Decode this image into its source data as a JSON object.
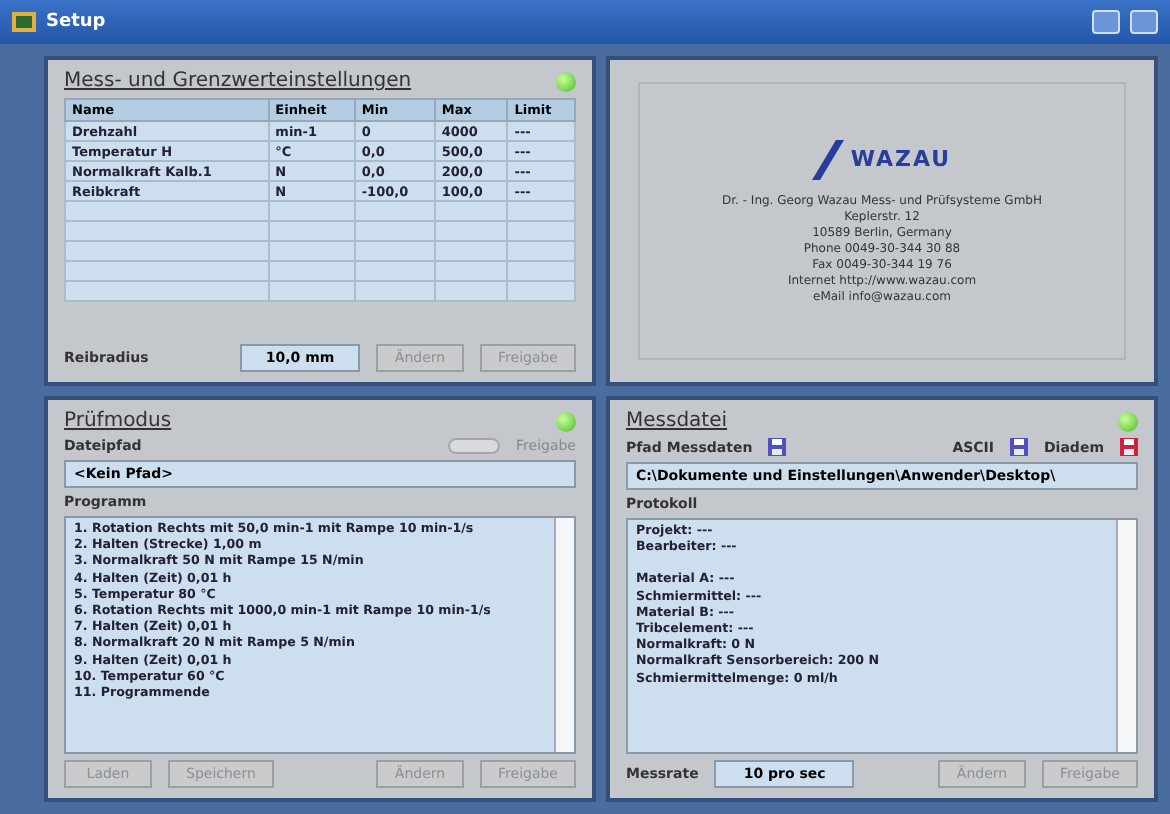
{
  "window": {
    "title": "Setup"
  },
  "limits_panel": {
    "title": "Mess- und Grenzwerteinstellungen",
    "led_on": true,
    "table": {
      "columns": [
        "Name",
        "Einheit",
        "Min",
        "Max",
        "Limit"
      ],
      "rows": [
        [
          "Drehzahl",
          "min-1",
          "0",
          "4000",
          "---"
        ],
        [
          "Temperatur H",
          "°C",
          "0,0",
          "500,0",
          "---"
        ],
        [
          "Normalkraft Kalb.1",
          "N",
          "0,0",
          "200,0",
          "---"
        ],
        [
          "Reibkraft",
          "N",
          "-100,0",
          "100,0",
          "---"
        ]
      ]
    },
    "radius": {
      "label": "Reibradius",
      "value": "10,0 mm"
    },
    "buttons": [
      {
        "label": "Ändern",
        "disabled": true
      },
      {
        "label": "Freigabe",
        "disabled": true
      }
    ]
  },
  "company_panel": {
    "logo": "WAZAU",
    "lines": [
      "Dr. - Ing. Georg Wazau Mess- und Prüfsysteme GmbH",
      "Keplerstr. 12",
      "10589 Berlin, Germany",
      "Phone 0049-30-344 30 88",
      "Fax 0049-30-344 19 76",
      "Internet http://www.wazau.com",
      "eMail info@wazau.com"
    ]
  },
  "test_panel": {
    "title": "Prüfmodus",
    "led_on": true,
    "path_label": "Dateipfad",
    "toggle_on": false,
    "toggle_label": "Freigabe",
    "path": "<Kein Pfad>",
    "program_label": "Programm",
    "program": [
      "1. Rotation Rechts mit 50,0 min-1 mit Rampe 10 min-1/s",
      "2. Halten (Strecke) 1,00 m",
      "3. Normalkraft 50 N mit Rampe 15 N/min",
      "4. Halten (Zeit) 0,01 h",
      "5. Temperatur 80 °C",
      "6. Rotation Rechts mit 1000,0 min-1 mit Rampe 10 min-1/s",
      "7. Halten (Zeit) 0,01 h",
      "8. Normalkraft 20 N mit Rampe 5 N/min",
      "9. Halten (Zeit) 0,01 h",
      "10. Temperatur 60 °C",
      "11. Programmende"
    ],
    "buttons": [
      {
        "label": "Laden",
        "disabled": true
      },
      {
        "label": "Speichern",
        "disabled": true
      },
      {
        "label": "Ändern",
        "disabled": true
      },
      {
        "label": "Freigabe",
        "disabled": true
      }
    ]
  },
  "file_panel": {
    "title": "Messdatei",
    "led_on": true,
    "formats": [
      {
        "label": "Pfad Messdaten",
        "color": "#5050c0"
      },
      {
        "label": "ASCII",
        "color": "#5050c0"
      },
      {
        "label": "Diadem",
        "color": "#d02040"
      }
    ],
    "path": "C:\\Dokumente und Einstellungen\\Anwender\\Desktop\\",
    "protocol_label": "Protokoll",
    "protocol": [
      [
        "Projekt: ---",
        "Bearbeiter: ---"
      ],
      [
        "Material A: ---",
        "Schmiermittel: ---",
        "Material B: ---",
        "Tribcelement: ---",
        "Normalkraft: 0 N",
        "Normalkraft Sensorbereich: 200 N",
        "Schmiermittelmenge: 0 ml/h"
      ]
    ],
    "rate": {
      "label": "Messrate",
      "value": "10 pro sec"
    },
    "buttons": [
      {
        "label": "Ändern",
        "disabled": true
      },
      {
        "label": "Freigabe",
        "disabled": true
      }
    ]
  }
}
